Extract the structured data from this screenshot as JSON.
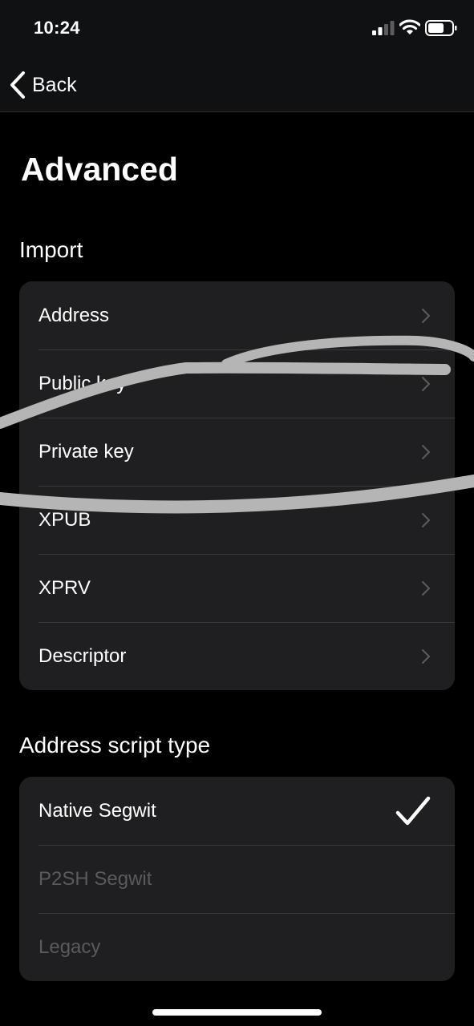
{
  "status_bar": {
    "time": "10:24",
    "icons": [
      "signal-icon",
      "wifi-icon",
      "battery-icon"
    ]
  },
  "nav": {
    "back_label": "Back",
    "back_icon": "chevron-left-icon"
  },
  "page": {
    "title": "Advanced"
  },
  "import_section": {
    "header": "Import",
    "items": [
      {
        "label": "Address"
      },
      {
        "label": "Public key"
      },
      {
        "label": "Private key"
      },
      {
        "label": "XPUB"
      },
      {
        "label": "XPRV"
      },
      {
        "label": "Descriptor"
      }
    ]
  },
  "script_section": {
    "header": "Address script type",
    "items": [
      {
        "label": "Native Segwit",
        "selected": true,
        "enabled": true
      },
      {
        "label": "P2SH Segwit",
        "selected": false,
        "enabled": false
      },
      {
        "label": "Legacy",
        "selected": false,
        "enabled": false
      }
    ]
  },
  "colors": {
    "background": "#000000",
    "bar_background": "#101113",
    "group_background": "#1f1f21",
    "separator": "#3a3a3c",
    "chevron": "#5c5c60",
    "disabled_text": "#5a5a5e",
    "scribble": "#b5b5b5"
  }
}
